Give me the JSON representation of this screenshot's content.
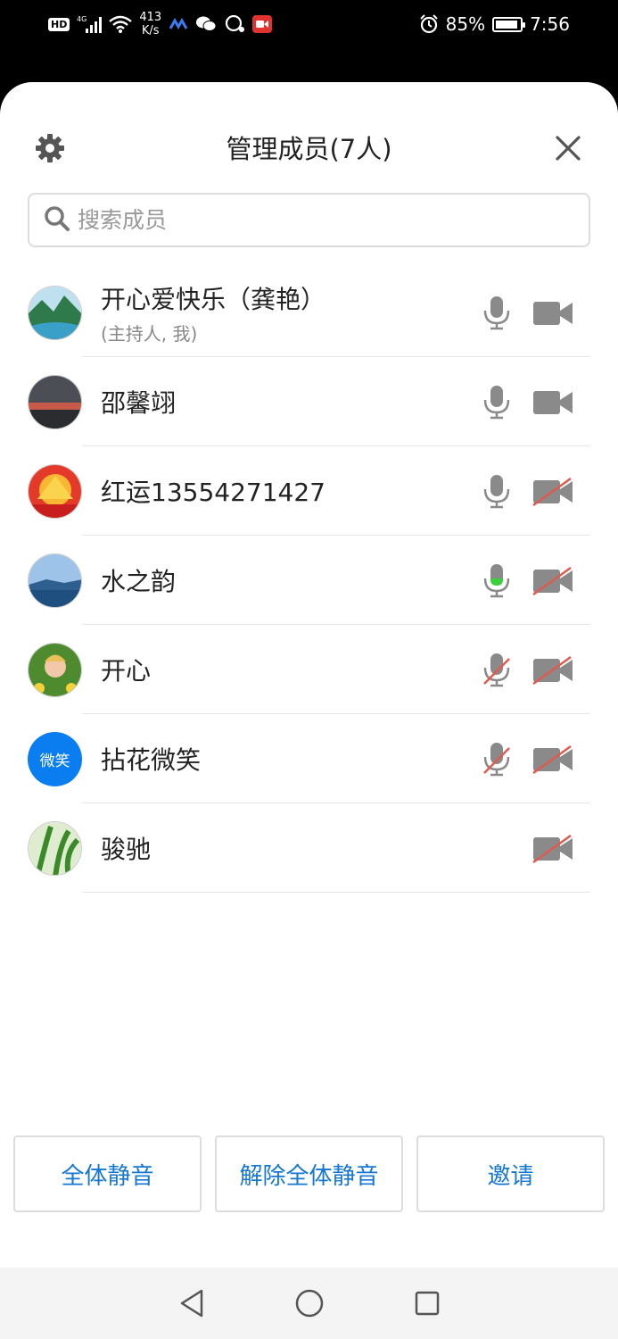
{
  "status_bar": {
    "hd": "HD",
    "net": "4G",
    "speed_top": "413",
    "speed_bottom": "K/s",
    "battery": "85%",
    "time": "7:56"
  },
  "header": {
    "title": "管理成员(7人)"
  },
  "search": {
    "placeholder": "搜索成员"
  },
  "members": [
    {
      "name": "开心爱快乐（龚艳）",
      "role": "(主持人, 我)",
      "mic": "on",
      "camera": "on"
    },
    {
      "name": "邵馨翊",
      "role": "",
      "mic": "on",
      "camera": "on"
    },
    {
      "name": "红运13554271427",
      "role": "",
      "mic": "on",
      "camera": "off"
    },
    {
      "name": "水之韵",
      "role": "",
      "mic": "speaking",
      "camera": "off"
    },
    {
      "name": "开心",
      "role": "",
      "mic": "off",
      "camera": "off"
    },
    {
      "name": "拈花微笑",
      "role": "",
      "mic": "off",
      "camera": "off",
      "avatar_text": "微笑"
    },
    {
      "name": "骏驰",
      "role": "",
      "mic": "none",
      "camera": "off"
    }
  ],
  "actions": {
    "mute_all": "全体静音",
    "unmute_all": "解除全体静音",
    "invite": "邀请"
  },
  "colors": {
    "accent": "#1677d2",
    "icon_gray": "#8a8a8a",
    "muted_red": "#e05a4e",
    "speaking_green": "#3ccf3c",
    "avatar_blue": "#0a7ef0"
  }
}
